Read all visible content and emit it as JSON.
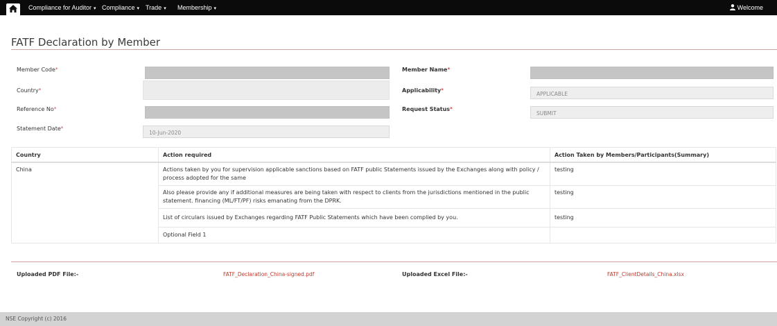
{
  "nav": {
    "items": [
      {
        "label": "Compliance for Auditor",
        "caret": "▾"
      },
      {
        "label": "Compliance",
        "caret": "▾"
      },
      {
        "label": "Trade",
        "caret": "▾"
      },
      {
        "label": "Membership",
        "caret": "▾"
      }
    ],
    "welcome": "Welcome"
  },
  "page": {
    "title": "FATF Declaration by Member"
  },
  "form": {
    "member_code_label": "Member Code",
    "member_name_label": "Member Name",
    "country_label": "Country",
    "applicability_label": "Applicability",
    "applicability_value": "APPLICABLE",
    "reference_no_label": "Reference No",
    "request_status_label": "Request Status",
    "request_status_value": "SUBMIT",
    "statement_date_label": "Statement Date",
    "statement_date_value": "10-Jun-2020",
    "required_mark": "*"
  },
  "table": {
    "headers": [
      "Country",
      "Action required",
      "Action Taken by Members/Participants(Summary)"
    ],
    "country": "China",
    "rows": [
      {
        "action": "Actions taken by you for supervision applicable sanctions based on FATF public Statements issued by the Exchanges along with policy / process adopted for the same",
        "taken": "testing"
      },
      {
        "action": "Also please provide any if additional measures are being taken with respect to clients from the jurisdictions mentioned in the public statement. financing (ML/FT/PF) risks emanating from the DPRK.",
        "taken": "testing"
      },
      {
        "action": "List of circulars issued by Exchanges regarding FATF Public Statements which have been complied by you.",
        "taken": "testing"
      },
      {
        "action": "Optional Field 1",
        "taken": ""
      }
    ]
  },
  "uploads": {
    "pdf_label": "Uploaded PDF File:-",
    "pdf_file": "FATF_Declaration_China-signed.pdf",
    "excel_label": "Uploaded Excel File:-",
    "excel_file": "FATF_ClientDetails_China.xlsx"
  },
  "footer": {
    "copyright": "NSE Copyright (c) 2016"
  },
  "colors": {
    "navbar": "#0b0b0b",
    "link": "#c0392b",
    "rule": "#c9a6a6"
  },
  "icons": [
    "home-icon",
    "user-icon"
  ]
}
